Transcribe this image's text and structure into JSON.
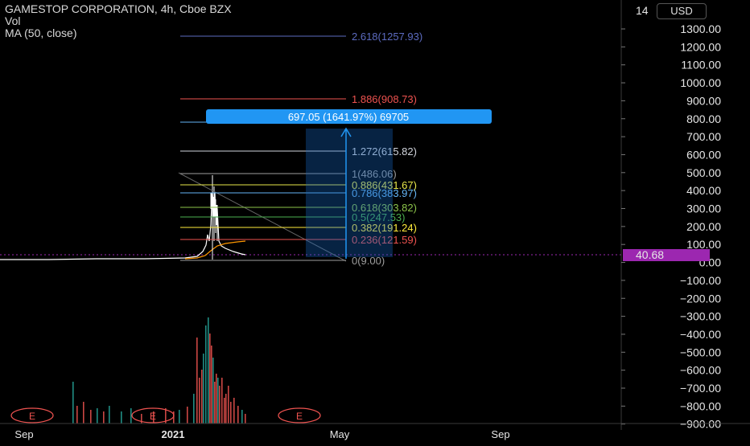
{
  "legend": {
    "title": "GAMESTOP CORPORATION, 4h, Cboe BZX",
    "vol": "Vol",
    "ma": "MA (50, close)"
  },
  "currency": "USD",
  "price_axis": {
    "ticks": [
      "1300.00",
      "1200.00",
      "1100.00",
      "1000.00",
      "900.00",
      "800.00",
      "700.00",
      "600.00",
      "500.00",
      "400.00",
      "300.00",
      "200.00",
      "100.00",
      "0.00",
      "−100.00",
      "−200.00",
      "−300.00",
      "−400.00",
      "−500.00",
      "−600.00",
      "−700.00",
      "−800.00",
      "−900.00"
    ],
    "top_partial": "14",
    "current_price": "40.68",
    "current_price_color": "#9c27b0"
  },
  "time_axis": {
    "labels": [
      "Sep",
      "2021",
      "May",
      "Sep"
    ]
  },
  "fib_levels": [
    {
      "label": "2.618(1257.93)",
      "color": "#5c6bc0"
    },
    {
      "label": "1.886(908.73)",
      "color": "#ef5350"
    },
    {
      "label": "1.272(615.82)",
      "color": "#d1d4dc"
    },
    {
      "label": "1(486.06)",
      "color": "#9e9e9e"
    },
    {
      "label": "0.886(431.67)",
      "color": "#e8e84a"
    },
    {
      "label": "0.786(383.97)",
      "color": "#64b5f6"
    },
    {
      "label": "0.618(303.82)",
      "color": "#8bc34a"
    },
    {
      "label": "0.5(247.53)",
      "color": "#4caf50"
    },
    {
      "label": "0.382(191.24)",
      "color": "#ffeb3b"
    },
    {
      "label": "0.236(121.59)",
      "color": "#ef5350"
    },
    {
      "label": "0(9.00)",
      "color": "#9e9e9e"
    }
  ],
  "measure_label": "697.05 (1641.97%) 69705",
  "earnings_marker": "E",
  "colors": {
    "accent": "#2196f3",
    "ma_line": "#ff9800",
    "candle": "#ffffff"
  }
}
